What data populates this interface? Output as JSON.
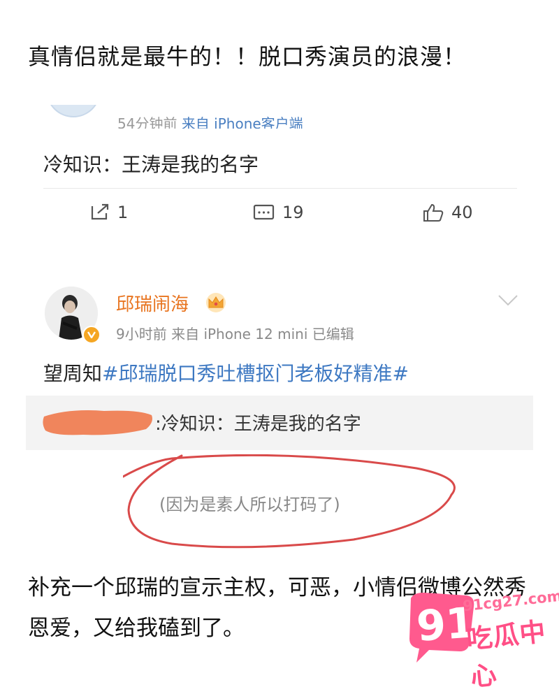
{
  "headline": "真情侣就是最牛的！！脱口秀演员的浪漫！",
  "first_post": {
    "meta_time": "54分钟前",
    "meta_source": "来自 iPhone客户端",
    "body": "冷知识：王涛是我的名字",
    "actions": {
      "repost_count": "1",
      "comment_count": "19",
      "like_count": "40"
    }
  },
  "second_post": {
    "user_name": "邱瑞闹海",
    "meta": "9小时前  来自 iPhone 12 mini  已编辑",
    "body_prefix": "望周知",
    "topic": "#邱瑞脱口秀吐槽抠门老板好精准#",
    "quote": ":冷知识：王涛是我的名字"
  },
  "annotation": "(因为是素人所以打码了)",
  "caption": "补充一个邱瑞的宣示主权，可恶，小情侣微博公然秀恩爱，又给我磕到了。",
  "watermark": {
    "number": "91",
    "url": "91cg27.com",
    "name": "吃瓜中心"
  },
  "colors": {
    "username": "#e8741f",
    "topic": "#3d78c2",
    "annotation_circle": "#d94a4a",
    "redaction": "#f07c4f",
    "watermark": "#ff4f86"
  }
}
